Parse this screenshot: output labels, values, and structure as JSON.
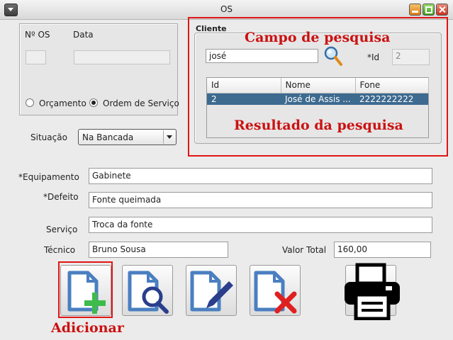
{
  "window": {
    "title": "OS"
  },
  "os_panel": {
    "num_label": "Nº OS",
    "date_label": "Data",
    "num_value": "",
    "date_value": "",
    "radio_orcamento": "Orçamento",
    "radio_ordem": "Ordem de Serviço",
    "selected": "Ordem de Serviço"
  },
  "situacao": {
    "label": "Situação",
    "value": "Na Bancada"
  },
  "cliente": {
    "title": "Cliente",
    "search_value": "josé",
    "id_label": "*Id",
    "id_value": "2",
    "columns": [
      "Id",
      "Nome",
      "Fone"
    ],
    "rows": [
      [
        "2",
        "José de Assis ...",
        "2222222222"
      ]
    ]
  },
  "form": {
    "equipamento_label": "*Equipamento",
    "equipamento_value": "Gabinete",
    "defeito_label": "*Defeito",
    "defeito_value": "Fonte queimada",
    "servico_label": "Serviço",
    "servico_value": "Troca da fonte",
    "tecnico_label": "Técnico",
    "tecnico_value": "Bruno Sousa",
    "valor_label": "Valor Total",
    "valor_value": "160,00"
  },
  "annotations": {
    "search": "Campo de pesquisa",
    "results": "Resultado da pesquisa",
    "add": "Adicionar"
  },
  "toolbar": {
    "icons": [
      "add-document-icon",
      "search-document-icon",
      "edit-document-icon",
      "delete-document-icon",
      "printer-icon"
    ]
  },
  "colors": {
    "selection": "#3d6a8f",
    "annotation": "#e01515",
    "doc_blue": "#4a7fc0",
    "add_green": "#3ebb4a",
    "delete_red": "#e02020"
  }
}
